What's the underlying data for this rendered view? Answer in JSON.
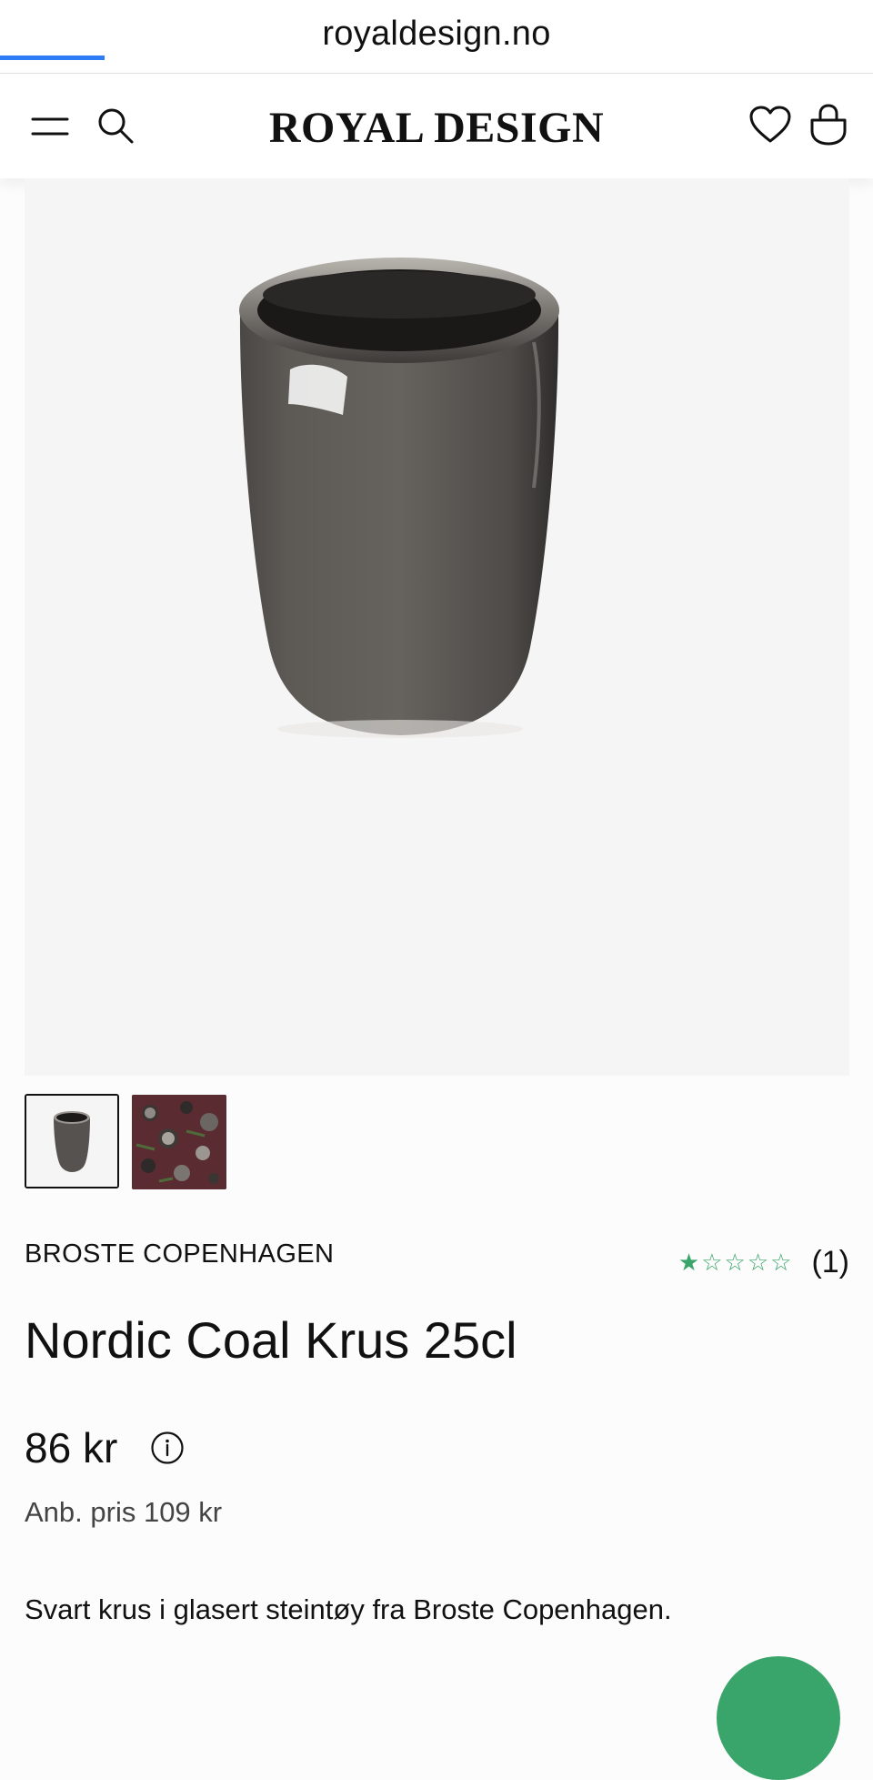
{
  "browser": {
    "url": "royaldesign.no",
    "load_progress": 0.12
  },
  "header": {
    "logo": "ROYAL DESIGN",
    "icons": {
      "menu": "menu-icon",
      "search": "search-icon",
      "wishlist": "heart-icon",
      "cart": "bag-icon"
    }
  },
  "product": {
    "brand": "BROSTE COPENHAGEN",
    "rating": {
      "value": 1,
      "max": 5,
      "count_label": "(1)"
    },
    "title": "Nordic Coal Krus 25cl",
    "price": "86 kr",
    "rrp": "Anb. pris 109 kr",
    "description": "Svart krus i glasert steintøy fra Broste Copenhagen.",
    "thumbnails": [
      "mug-photo",
      "pattern-photo"
    ],
    "selected_thumbnail": 0
  },
  "colors": {
    "accent_blue": "#2f7df6",
    "rating_green": "#3aa56b",
    "image_bg": "#f5f5f5"
  }
}
